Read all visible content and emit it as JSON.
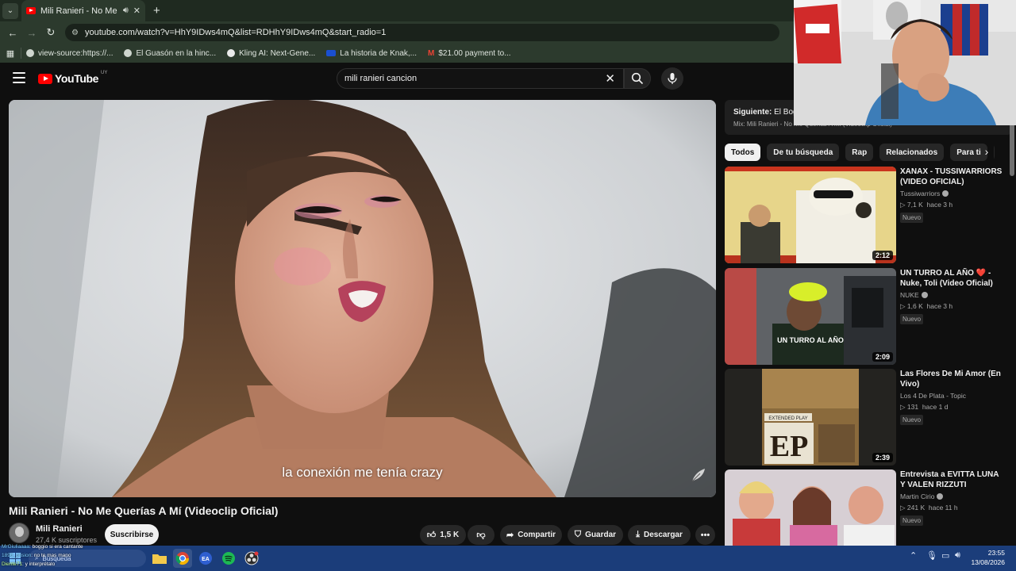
{
  "browser": {
    "tab_title": "Mili Ranieri - No Me Querías",
    "url": "youtube.com/watch?v=HhY9IDws4mQ&list=RDHhY9IDws4mQ&start_radio=1",
    "bookmarks": [
      {
        "label": "view-source:https://..."
      },
      {
        "label": "El Guasón en la hinc..."
      },
      {
        "label": "Kling AI: Next-Gene..."
      },
      {
        "label": "La historia de Knak,..."
      },
      {
        "label": "$21.00 payment to..."
      }
    ]
  },
  "youtube": {
    "logo_text": "YouTube",
    "region": "UY",
    "search_query": "mili ranieri cancion"
  },
  "video": {
    "subtitle": "la conexión me tenía crazy",
    "title": "Mili Ranieri - No Me Querías A Mí (Videoclip Oficial)",
    "channel": "Mili Ranieri",
    "subscribers": "27,4 K suscriptores",
    "subscribe_label": "Suscribirse",
    "likes": "1,5 K",
    "share_label": "Compartir",
    "save_label": "Guardar",
    "download_label": "Descargar"
  },
  "up_next": {
    "label": "Siguiente:",
    "next_title": "El Bogu",
    "mix": "Mix: Mili Ranieri - No Me Querías A Mí (Videoclip Oficial)"
  },
  "chips": [
    "Todos",
    "De tu búsqueda",
    "Rap",
    "Relacionados",
    "Para ti",
    "S"
  ],
  "recommendations": [
    {
      "title": "XANAX - TUSSIWARRIORS (VIDEO OFICIAL)",
      "channel": "Tussiwarriors",
      "views": "7,1 K",
      "age": "hace 3 h",
      "badge": "Nuevo",
      "duration": "2:12"
    },
    {
      "title": "UN TURRO AL AÑO ❤️ - Nuke, Toli (Video Oficial)",
      "channel": "NUKE",
      "views": "1,6 K",
      "age": "hace 3 h",
      "badge": "Nuevo",
      "duration": "2:09",
      "thumb_text": "UN TURRO AL AÑO"
    },
    {
      "title": "Las Flores De Mi Amor (En Vivo)",
      "channel": "Los 4 De Plata - Topic",
      "views": "131",
      "age": "hace 1 d",
      "badge": "Nuevo",
      "duration": "2:39",
      "thumb_text_1": "EXTENDED PLAY",
      "thumb_text_2": "EP"
    },
    {
      "title": "Entrevista a EVITTA LUNA Y VALEN RIZZUTI",
      "channel": "Martin Cirio",
      "views": "241 K",
      "age": "hace 11 h",
      "badge": "Nuevo",
      "duration": ""
    }
  ],
  "taskbar": {
    "search_text": "Búsqueda",
    "time": "23:55",
    "date": "13/08/2026"
  },
  "chat": {
    "line1_user": "MrGiuliaaaa",
    "line1_text": ": boggio si era cantante",
    "line2_user": "1896_prision",
    "line2_text": ": no te mas mano",
    "line3_user": "Diente71",
    "line3_text": ": y interprétalo"
  },
  "colors": {
    "youtube_red": "#ff0000",
    "browser_theme": "#2c3a2d",
    "background": "#0f0f0f"
  }
}
